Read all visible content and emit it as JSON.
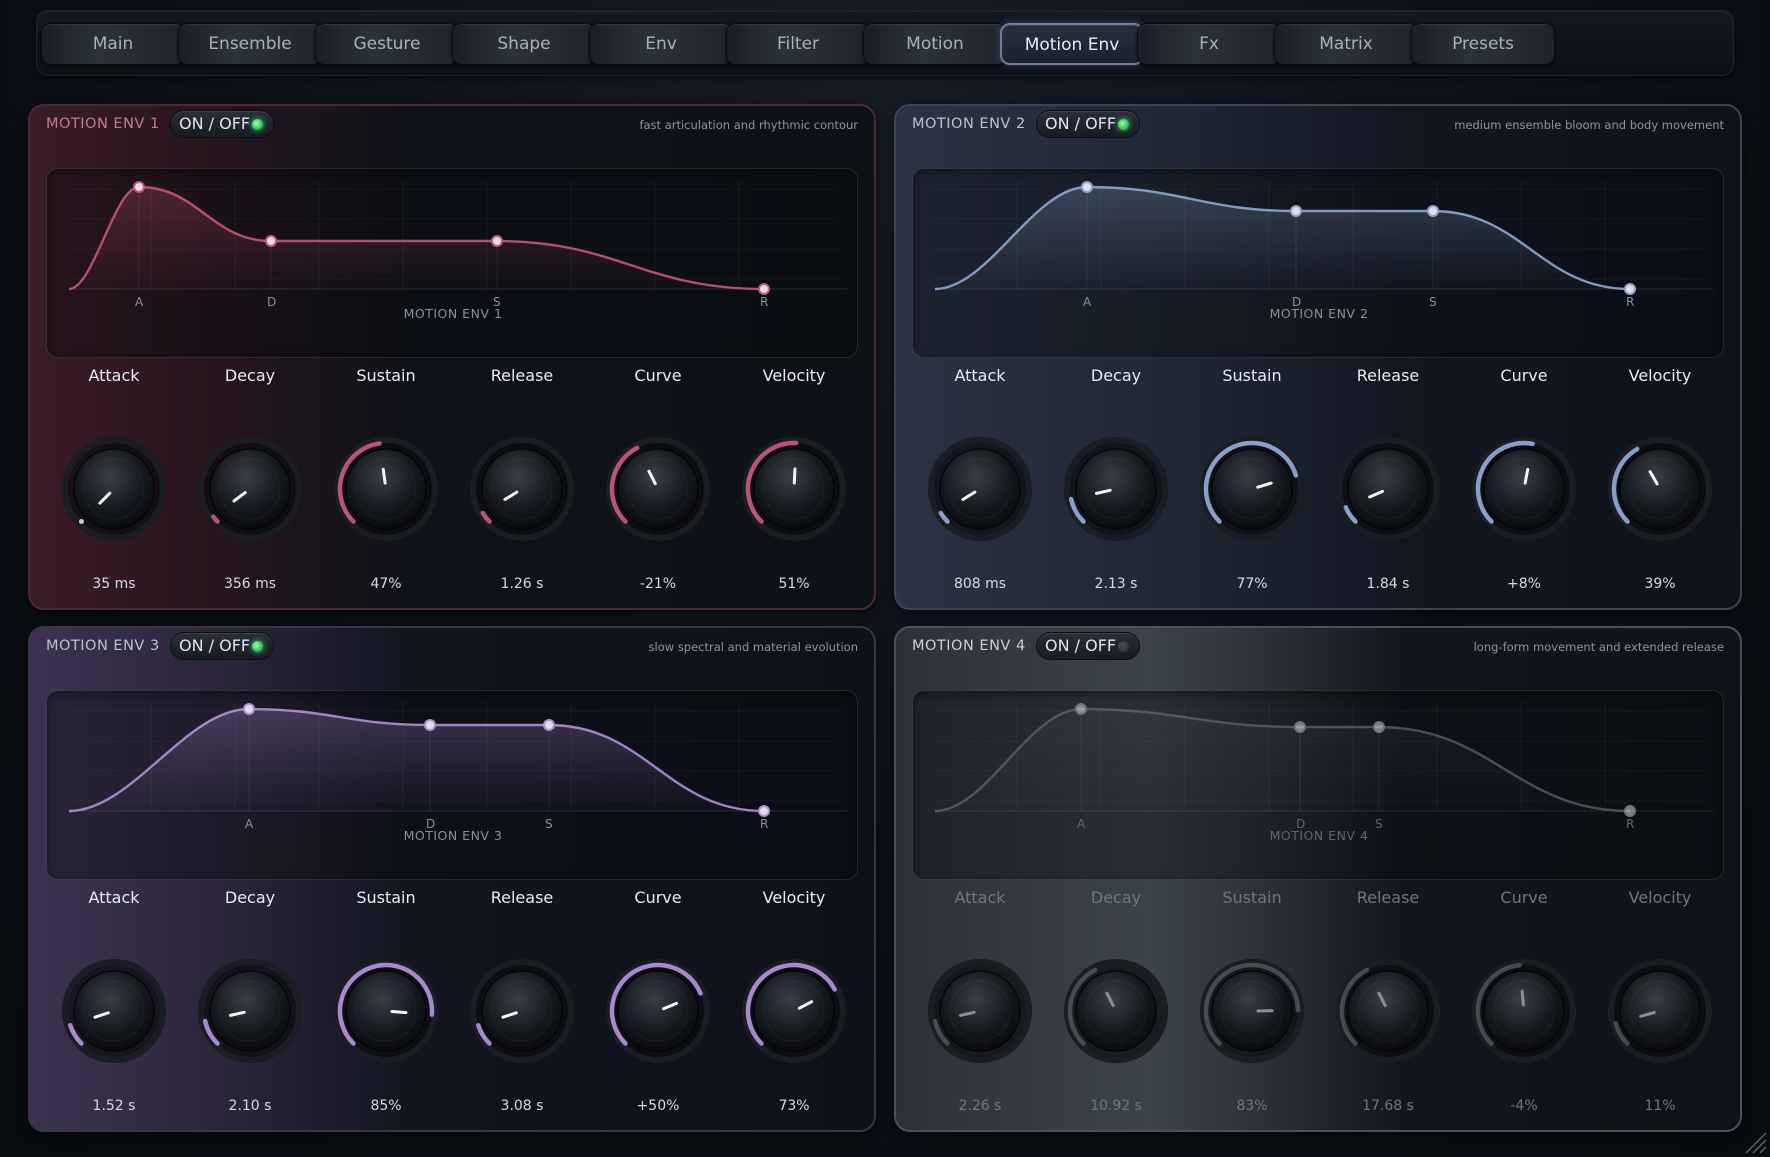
{
  "tabs": [
    {
      "label": "Main",
      "active": false
    },
    {
      "label": "Ensemble",
      "active": false
    },
    {
      "label": "Gesture",
      "active": false
    },
    {
      "label": "Shape",
      "active": false
    },
    {
      "label": "Env",
      "active": false
    },
    {
      "label": "Filter",
      "active": false
    },
    {
      "label": "Motion",
      "active": false
    },
    {
      "label": "Motion Env",
      "active": true
    },
    {
      "label": "Fx",
      "active": false
    },
    {
      "label": "Matrix",
      "active": false
    },
    {
      "label": "Presets",
      "active": false
    }
  ],
  "toggle_label": "ON / OFF",
  "point_labels": [
    "A",
    "D",
    "S",
    "R"
  ],
  "panels": [
    {
      "title": "MOTION ENV 1",
      "description": "fast articulation and rhythmic contour",
      "enabled": true,
      "accent": "#c4577a",
      "graph_name": "MOTION ENV 1",
      "knobs": [
        {
          "label": "Attack",
          "value": "35 ms",
          "level": 0.0
        },
        {
          "label": "Decay",
          "value": "356 ms",
          "level": 0.03
        },
        {
          "label": "Sustain",
          "value": "47%",
          "level": 0.47
        },
        {
          "label": "Release",
          "value": "1.26 s",
          "level": 0.05
        },
        {
          "label": "Curve",
          "value": "-21%",
          "level": 0.4
        },
        {
          "label": "Velocity",
          "value": "51%",
          "level": 0.51
        }
      ]
    },
    {
      "title": "MOTION ENV 2",
      "description": "medium ensemble bloom and body movement",
      "enabled": true,
      "accent": "#8fa6cf",
      "graph_name": "MOTION ENV 2",
      "knobs": [
        {
          "label": "Attack",
          "value": "808 ms",
          "level": 0.05
        },
        {
          "label": "Decay",
          "value": "2.13 s",
          "level": 0.12
        },
        {
          "label": "Sustain",
          "value": "77%",
          "level": 0.77
        },
        {
          "label": "Release",
          "value": "1.84 s",
          "level": 0.08
        },
        {
          "label": "Curve",
          "value": "+8%",
          "level": 0.54
        },
        {
          "label": "Velocity",
          "value": "39%",
          "level": 0.39
        }
      ]
    },
    {
      "title": "MOTION ENV 3",
      "description": "slow spectral and material evolution",
      "enabled": true,
      "accent": "#b08fd6",
      "graph_name": "MOTION ENV 3",
      "knobs": [
        {
          "label": "Attack",
          "value": "1.52 s",
          "level": 0.1
        },
        {
          "label": "Decay",
          "value": "2.10 s",
          "level": 0.12
        },
        {
          "label": "Sustain",
          "value": "85%",
          "level": 0.85
        },
        {
          "label": "Release",
          "value": "3.08 s",
          "level": 0.1
        },
        {
          "label": "Curve",
          "value": "+50%",
          "level": 0.75
        },
        {
          "label": "Velocity",
          "value": "73%",
          "level": 0.73
        }
      ]
    },
    {
      "title": "MOTION ENV 4",
      "description": "long-form movement and extended release",
      "enabled": false,
      "accent": "#6e7580",
      "graph_name": "MOTION ENV 4",
      "knobs": [
        {
          "label": "Attack",
          "value": "2.26 s",
          "level": 0.12
        },
        {
          "label": "Decay",
          "value": "10.92 s",
          "level": 0.4
        },
        {
          "label": "Sustain",
          "value": "83%",
          "level": 0.83
        },
        {
          "label": "Release",
          "value": "17.68 s",
          "level": 0.4
        },
        {
          "label": "Curve",
          "value": "-4%",
          "level": 0.48
        },
        {
          "label": "Velocity",
          "value": "11%",
          "level": 0.11
        }
      ]
    }
  ]
}
